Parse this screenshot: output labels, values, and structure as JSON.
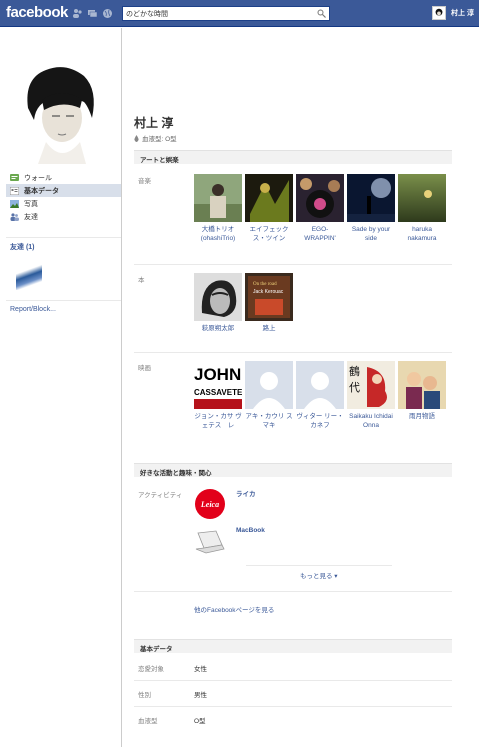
{
  "topbar": {
    "logo": "facebook",
    "search_value": "のどかな時間",
    "user_name": "村上 淳",
    "colors": {
      "bar": "#3b5998",
      "link": "#3b5998"
    }
  },
  "sidebar": {
    "items": [
      {
        "label": "ウォール",
        "icon": "wall-icon"
      },
      {
        "label": "基本データ",
        "icon": "info-icon"
      },
      {
        "label": "写真",
        "icon": "photos-icon"
      },
      {
        "label": "友達",
        "icon": "friends-icon"
      }
    ],
    "friends_heading": "友達 (1)",
    "report": "Report/Block..."
  },
  "profile": {
    "name": "村上 淳",
    "blood_type": "血液型: O型"
  },
  "arts": {
    "heading": "アートと娯楽",
    "music_label": "音楽",
    "music": [
      {
        "caption": "大橋トリオ (ohashiTrio)"
      },
      {
        "caption": "エイフェック ス・ツイン"
      },
      {
        "caption": "EGO-WRAPPIN'"
      },
      {
        "caption": "Sade by your side"
      },
      {
        "caption": "haruka nakamura"
      }
    ],
    "books_label": "本",
    "books": [
      {
        "caption": "萩原朔太郎"
      },
      {
        "caption": "路上"
      }
    ],
    "movies_label": "映画",
    "movies": [
      {
        "caption": "ジョン・カサ ヴェテス　レ"
      },
      {
        "caption": "アキ・カウリ スマキ"
      },
      {
        "caption": "ヴィター リー・カネフ"
      },
      {
        "caption": "Saikaku Ichidai Onna"
      },
      {
        "caption": "雨月物語"
      }
    ]
  },
  "activities": {
    "heading": "好きな活動と趣味・関心",
    "label": "アクティビティ",
    "items": [
      {
        "title": "ライカ",
        "logo_text": "Leica"
      },
      {
        "title": "MacBook"
      }
    ],
    "more": "もっと見る ▾",
    "pages_link": "他のFacebookページを見る"
  },
  "basic": {
    "heading": "基本データ",
    "rows": [
      {
        "label": "恋愛対象",
        "value": "女性"
      },
      {
        "label": "性別",
        "value": "男性"
      },
      {
        "label": "血液型",
        "value": "O型"
      }
    ]
  }
}
